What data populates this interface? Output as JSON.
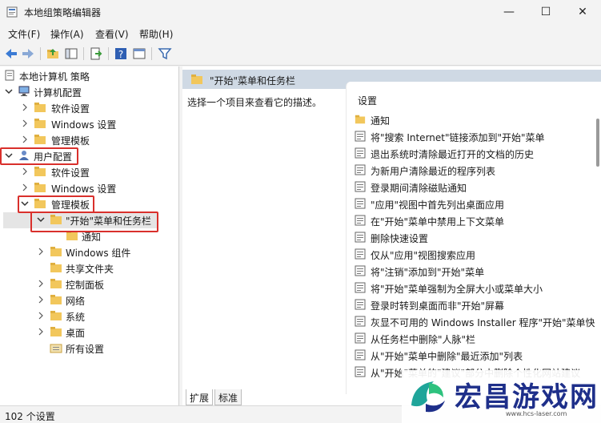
{
  "window": {
    "title": "本地组策略编辑器",
    "minimize_glyph": "—",
    "maximize_glyph": "☐",
    "close_glyph": "✕"
  },
  "menu": [
    "文件(F)",
    "操作(A)",
    "查看(V)",
    "帮助(H)"
  ],
  "toolbar": {
    "icons": [
      "back-arrow-icon",
      "forward-arrow-icon",
      "up-folder-icon",
      "show-hide-tree-icon",
      "export-list-icon",
      "help-icon",
      "properties-icon",
      "filter-icon"
    ]
  },
  "tree": {
    "root": "本地计算机 策略",
    "computer_config": "计算机配置",
    "cc_software": "软件设置",
    "cc_windows": "Windows 设置",
    "cc_admin": "管理模板",
    "user_config": "用户配置",
    "uc_software": "软件设置",
    "uc_windows": "Windows 设置",
    "uc_admin": "管理模板",
    "start_menu": "\"开始\"菜单和任务栏",
    "notify": "通知",
    "win_components": "Windows 组件",
    "shared_folders": "共享文件夹",
    "control_panel": "控制面板",
    "network": "网络",
    "system": "系统",
    "desktop": "桌面",
    "all_settings": "所有设置"
  },
  "right": {
    "header": "\"开始\"菜单和任务栏",
    "description": "选择一个项目来查看它的描述。",
    "settings_header": "设置",
    "folder_item": "通知",
    "settings": [
      "将\"搜索 Internet\"链接添加到\"开始\"菜单",
      "退出系统时清除最近打开的文档的历史",
      "为新用户清除最近的程序列表",
      "登录期间清除磁贴通知",
      "\"应用\"视图中首先列出桌面应用",
      "在\"开始\"菜单中禁用上下文菜单",
      "删除快速设置",
      "仅从\"应用\"视图搜索应用",
      "将\"注销\"添加到\"开始\"菜单",
      "将\"开始\"菜单强制为全屏大小或菜单大小",
      "登录时转到桌面而非\"开始\"屏幕",
      "灰显不可用的 Windows Installer 程序\"开始\"菜单快",
      "从任务栏中删除\"人脉\"栏",
      "从\"开始\"菜单中删除\"最近添加\"列表",
      "从\"开始\"菜单的\"建议\"部分中删除个性化网站建议"
    ]
  },
  "tabs": [
    "扩展",
    "标准"
  ],
  "status": "102 个设置",
  "watermark": {
    "brand": "宏昌游戏网",
    "url": "www.hcs-laser.com"
  },
  "colors": {
    "highlight_box": "#d9302c",
    "header_band": "#cfd9e4",
    "folder": "#f2c75c",
    "selected_row": "#e5e5e5"
  }
}
